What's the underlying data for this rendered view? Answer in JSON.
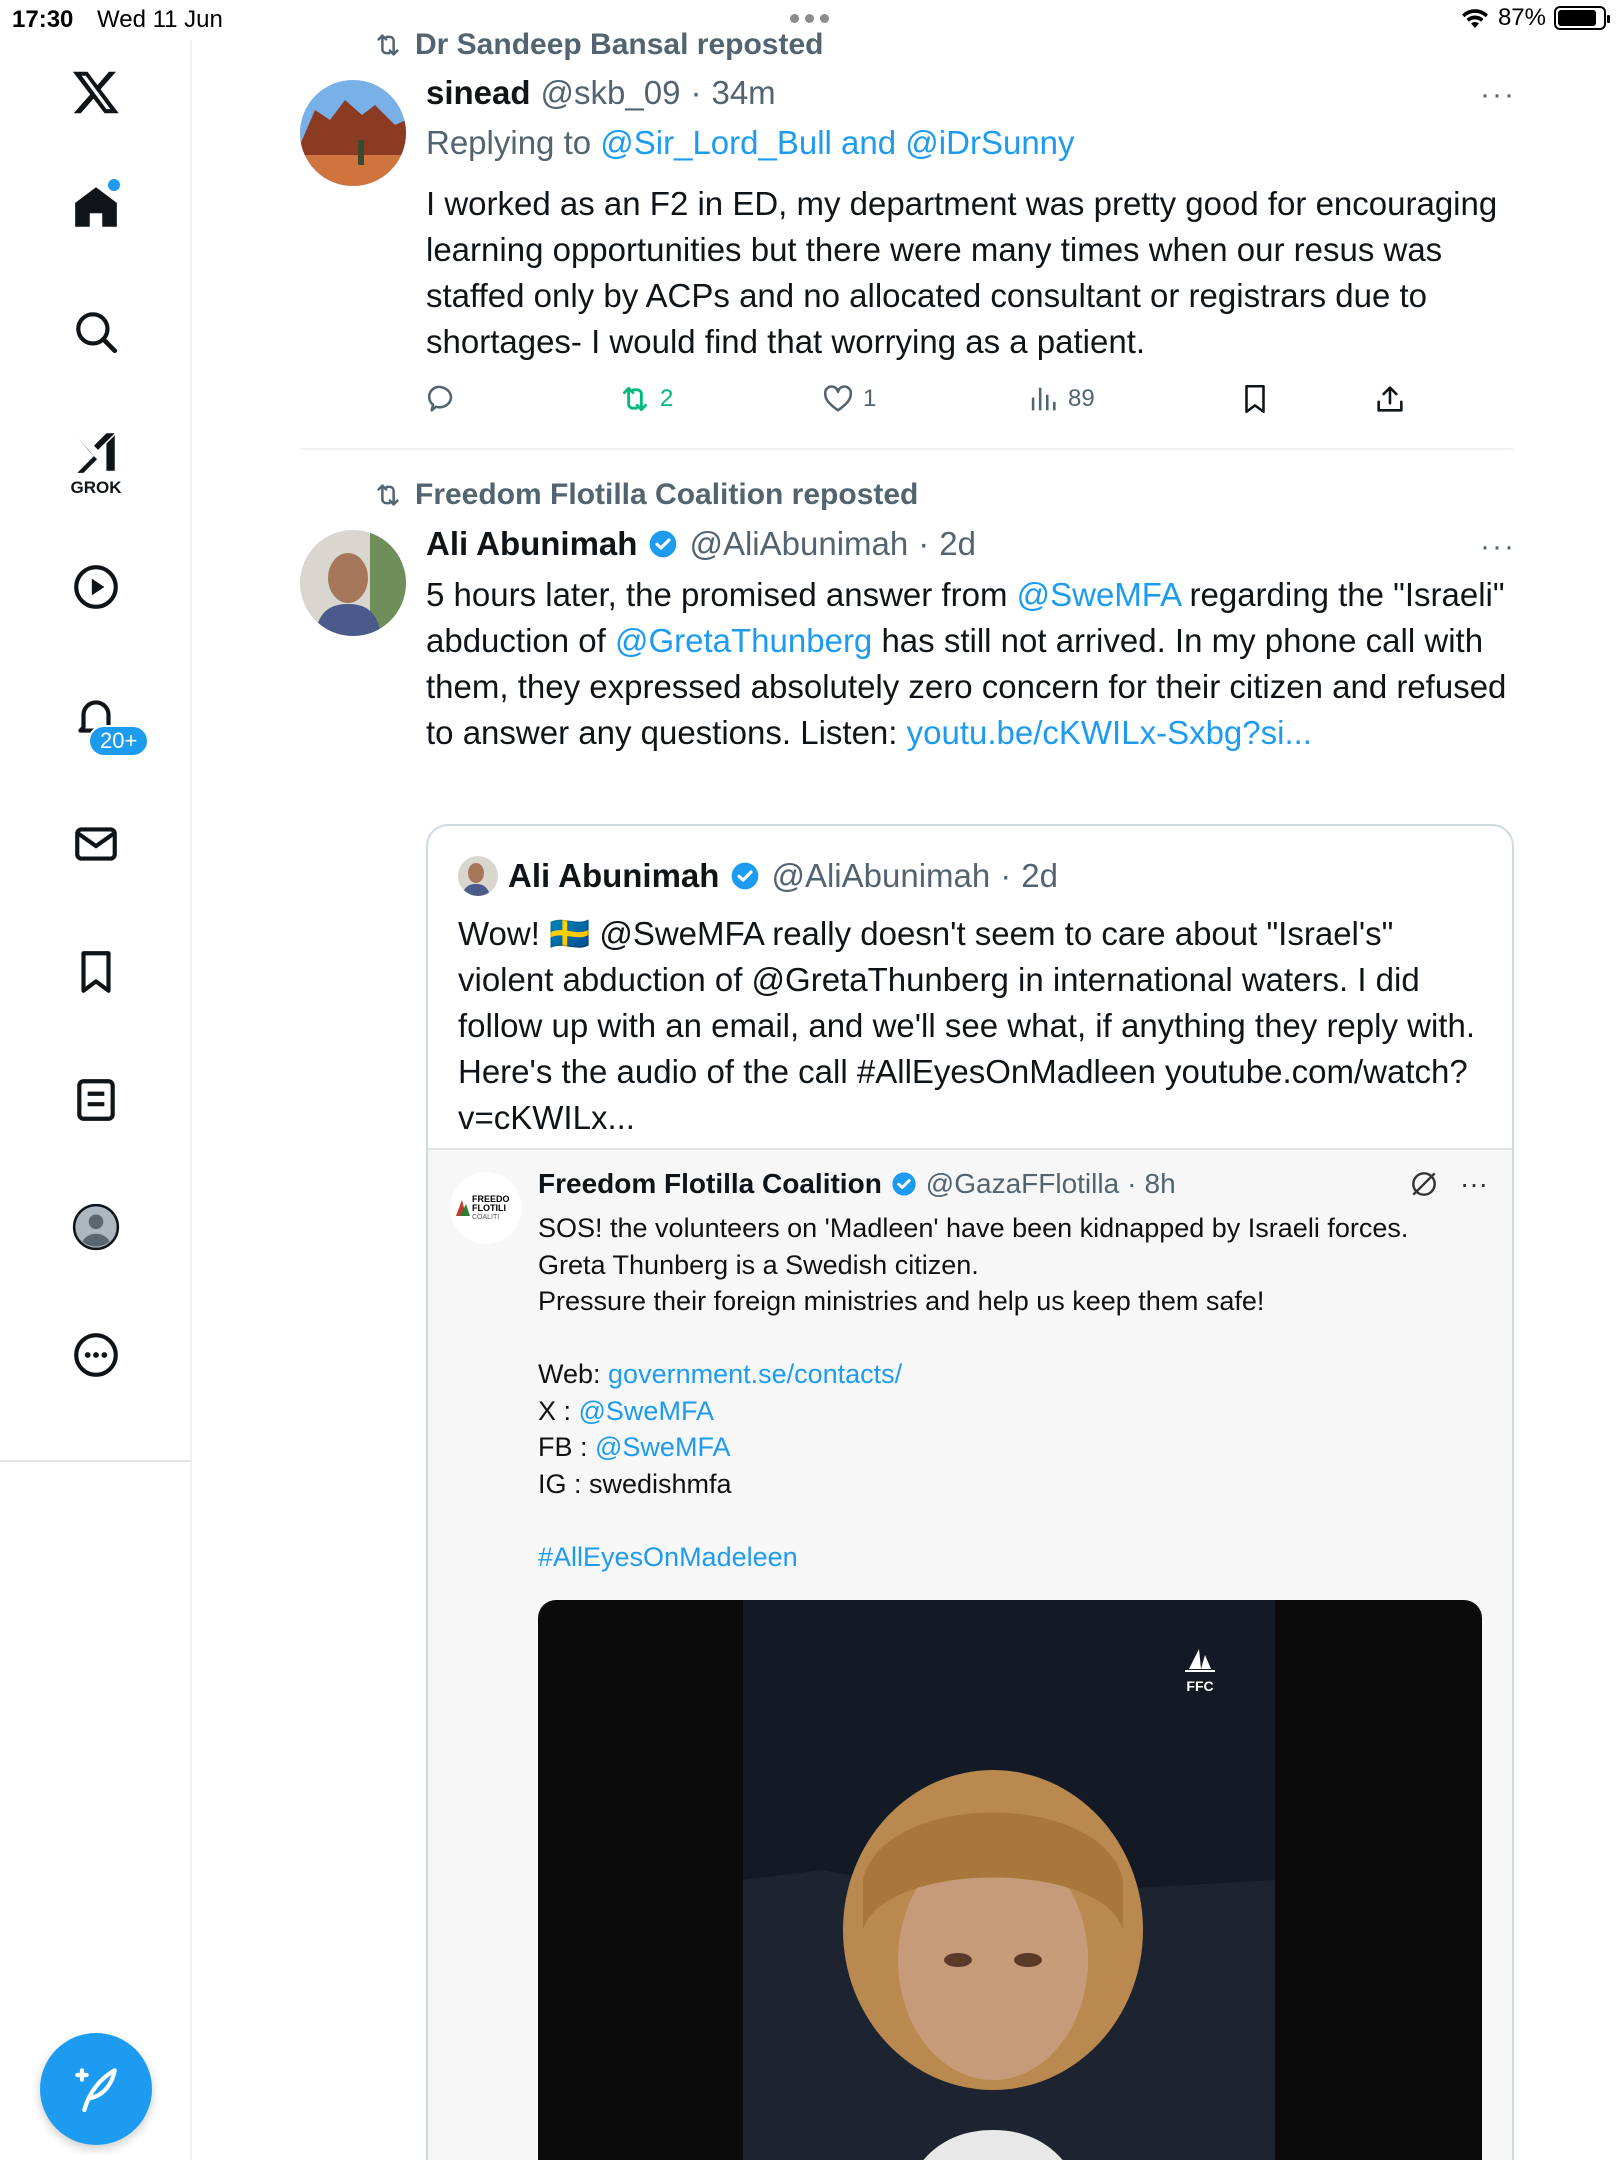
{
  "status_bar": {
    "time": "17:30",
    "date": "Wed 11 Jun",
    "battery": "87%",
    "battery_level": 0.87
  },
  "sidebar": {
    "grok_label": "GROK",
    "notifications_badge": "20+",
    "icons": [
      "x-logo-icon",
      "home-icon",
      "search-icon",
      "grok-icon",
      "video-icon",
      "notifications-icon",
      "messages-icon",
      "bookmarks-icon",
      "lists-icon",
      "profile-icon",
      "more-icon"
    ]
  },
  "tweets": [
    {
      "repost_by": "Dr Sandeep Bansal reposted",
      "name": "sinead",
      "handle": "@skb_09",
      "time": "34m",
      "replying_prefix": "Replying to ",
      "replying_1": "@Sir_Lord_Bull",
      "replying_and": " and ",
      "replying_2": "@iDrSunny",
      "text": "I worked as an F2 in ED, my department was pretty good for encouraging learning opportunities but there were many times when our resus was staffed only by ACPs and no allocated consultant or registrars due to shortages- I would find that worrying as a patient.",
      "reposts": "2",
      "likes": "1",
      "views": "89"
    },
    {
      "repost_by": "Freedom Flotilla Coalition reposted",
      "name": "Ali Abunimah",
      "handle": "@AliAbunimah",
      "time": "2d",
      "text_parts": {
        "p1": "5 hours later, the promised answer from ",
        "m1": "@SweMFA",
        "p2": " regarding the \"Israeli\" abduction of ",
        "m2": "@GretaThunberg",
        "p3": " has still not arrived. In my phone call with them, they expressed absolutely zero concern for their citizen and refused to answer any questions. Listen: ",
        "link": "youtu.be/cKWILx-Sxbg?si..."
      }
    }
  ],
  "quote": {
    "name": "Ali Abunimah",
    "handle": "@AliAbunimah",
    "time": "2d",
    "text_a": "Wow! ",
    "flag": "🇸🇪",
    "text_b": " @SweMFA really doesn't seem to care about \"Israel's\" violent abduction of @GretaThunberg in international waters. I did follow up with an email, and we'll see what, if anything they reply with. Here's the audio of the call #AllEyesOnMadleen youtube.com/watch?v=cKWILx..."
  },
  "embed": {
    "name": "Freedom Flotilla Coalition",
    "handle": "@GazaFFlotilla",
    "time": "8h",
    "logo_text_1": "FREEDO",
    "logo_text_2": "FLOTILI",
    "logo_text_3": "COALITI",
    "line1": "SOS! the volunteers on 'Madleen' have been kidnapped by Israeli forces.",
    "line2": "Greta Thunberg is a Swedish citizen.",
    "line3": "Pressure their foreign ministries and help us keep them safe!",
    "web_label": "Web: ",
    "web_link": "government.se/contacts/",
    "x_label": "X : ",
    "x_link": "@SweMFA",
    "fb_label": "FB : ",
    "fb_link": "@SweMFA",
    "ig_line": "IG : swedishmfa",
    "hashtag": "#AllEyesOnMadeleen",
    "video_mark": "FFC"
  }
}
